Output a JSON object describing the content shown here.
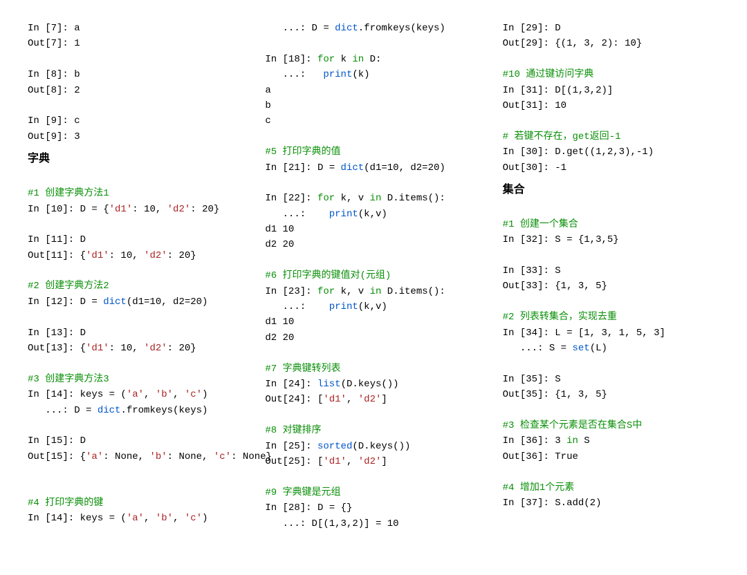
{
  "col1": {
    "l01": "In [7]: a",
    "l02": "Out[7]: 1",
    "l03": "In [8]: b",
    "l04": "Out[8]: 2",
    "l05": "In [9]: c",
    "l06": "Out[9]: 3",
    "h1": "字典",
    "c1": "#1 创建字典方法1",
    "l07a": "In [10]: D = {",
    "l07b": "'d1'",
    "l07c": ": 10, ",
    "l07d": "'d2'",
    "l07e": ": 20}",
    "l08": "In [11]: D",
    "l09a": "Out[11]: {",
    "l09b": "'d1'",
    "l09c": ": 10, ",
    "l09d": "'d2'",
    "l09e": ": 20}",
    "c2": "#2 创建字典方法2",
    "l10a": "In [12]: D = ",
    "l10b": "dict",
    "l10c": "(d1=10, d2=20)",
    "l11": "In [13]: D",
    "l12a": "Out[13]: {",
    "l12b": "'d1'",
    "l12c": ": 10, ",
    "l12d": "'d2'",
    "l12e": ": 20}",
    "c3": "#3 创建字典方法3",
    "l13a": "In [14]: keys = (",
    "l13b": "'a'",
    "l13c": ", ",
    "l13d": "'b'",
    "l13e": ", ",
    "l13f": "'c'",
    "l13g": ")",
    "l14a": "   ...: D = ",
    "l14b": "dict",
    "l14c": ".fromkeys(keys)",
    "l15": "In [15]: D",
    "l16a": "Out[15]: {",
    "l16b": "'a'",
    "l16c": ": None, ",
    "l16d": "'b'",
    "l16e": ": None, ",
    "l16f": "'c'",
    "l16g": ": None}",
    "c4": "#4 打印字典的键",
    "l17a": "In [14]: keys = (",
    "l17b": "'a'",
    "l17c": ", ",
    "l17d": "'b'",
    "l17e": ", ",
    "l17f": "'c'",
    "l17g": ")"
  },
  "col2": {
    "l01a": "   ...: D = ",
    "l01b": "dict",
    "l01c": ".fromkeys(keys)",
    "l02a": "In [18]: ",
    "l02b": "for",
    "l02c": " k ",
    "l02d": "in",
    "l02e": " D:",
    "l03a": "   ...:   ",
    "l03b": "print",
    "l03c": "(k)",
    "l04": "a",
    "l05": "b",
    "l06": "c",
    "c5": "#5 打印字典的值",
    "l07a": "In [21]: D = ",
    "l07b": "dict",
    "l07c": "(d1=10, d2=20)",
    "l08a": "In [22]: ",
    "l08b": "for",
    "l08c": " k, v ",
    "l08d": "in",
    "l08e": " D.items():",
    "l09a": "   ...:    ",
    "l09b": "print",
    "l09c": "(k,v)",
    "l10": "d1 10",
    "l11": "d2 20",
    "c6": "#6 打印字典的键值对(元组)",
    "l12a": "In [23]: ",
    "l12b": "for",
    "l12c": " k, v ",
    "l12d": "in",
    "l12e": " D.items():",
    "l13a": "   ...:    ",
    "l13b": "print",
    "l13c": "(k,v)",
    "l14": "d1 10",
    "l15": "d2 20",
    "c7": "#7 字典键转列表",
    "l16a": "In [24]: ",
    "l16b": "list",
    "l16c": "(D.keys())",
    "l17a": "Out[24]: [",
    "l17b": "'d1'",
    "l17c": ", ",
    "l17d": "'d2'",
    "l17e": "]",
    "c8": "#8 对键排序",
    "l18a": "In [25]: ",
    "l18b": "sorted",
    "l18c": "(D.keys())",
    "l19a": "Out[25]: [",
    "l19b": "'d1'",
    "l19c": ", ",
    "l19d": "'d2'",
    "l19e": "]",
    "c9": "#9 字典键是元组",
    "l20": "In [28]: D = {}",
    "l21": "   ...: D[(1,3,2)] = 10"
  },
  "col3": {
    "l01": "In [29]: D",
    "l02": "Out[29]: {(1, 3, 2): 10}",
    "c10": "#10 通过键访问字典",
    "l03": "In [31]: D[(1,3,2)]",
    "l04": "Out[31]: 10",
    "c10b": "# 若键不存在，get返回-1",
    "l05": "In [30]: D.get((1,2,3),-1)",
    "l06": "Out[30]: -1",
    "h2": "集合",
    "c11": "#1 创建一个集合",
    "l07": "In [32]: S = {1,3,5}",
    "l08": "In [33]: S",
    "l09": "Out[33]: {1, 3, 5}",
    "c12": "#2 列表转集合，实现去重",
    "l10": "In [34]: L = [1, 3, 1, 5, 3]",
    "l11a": "   ...: S = ",
    "l11b": "set",
    "l11c": "(L)",
    "l12": "In [35]: S",
    "l13": "Out[35]: {1, 3, 5}",
    "c13": "#3 检查某个元素是否在集合S中",
    "l14a": "In [36]: 3 ",
    "l14b": "in",
    "l14c": " S",
    "l15": "Out[36]: True",
    "c14": "#4 增加1个元素",
    "l16": "In [37]: S.add(2)"
  }
}
